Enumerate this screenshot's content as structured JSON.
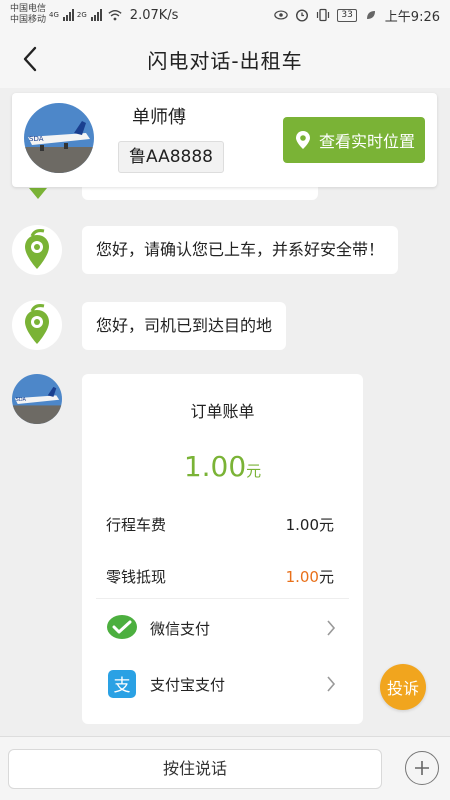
{
  "status_bar": {
    "carrier_1": "中国电信",
    "carrier_2": "中国移动",
    "net_1": "4G",
    "net_2": "2G",
    "speed": "2.07K/s",
    "battery": "33",
    "time": "上午9:26"
  },
  "header": {
    "title": "闪电对话-出租车"
  },
  "driver": {
    "name": "单师傅",
    "plate": "鲁AA8888",
    "location_button": "查看实时位置"
  },
  "messages": [
    {
      "text": "您好，请确认您已上车，并系好安全带！"
    },
    {
      "text": "您好，司机已到达目的地"
    }
  ],
  "bill": {
    "title": "订单账单",
    "amount": "1.00",
    "amount_unit": "元",
    "rows": [
      {
        "label": "行程车费",
        "value": "1.00元"
      },
      {
        "label": "零钱抵现",
        "value_num": "1.00",
        "value_unit": "元"
      }
    ],
    "payments": [
      {
        "label": "微信支付",
        "icon": "wechat-pay-icon"
      },
      {
        "label": "支付宝支付",
        "icon": "alipay-icon"
      }
    ]
  },
  "complaint_button": "投诉",
  "input_bar": {
    "hold_to_talk": "按住说话"
  },
  "colors": {
    "brand_green": "#7ab336",
    "orange": "#e8701a",
    "complaint": "#f1a51e"
  }
}
